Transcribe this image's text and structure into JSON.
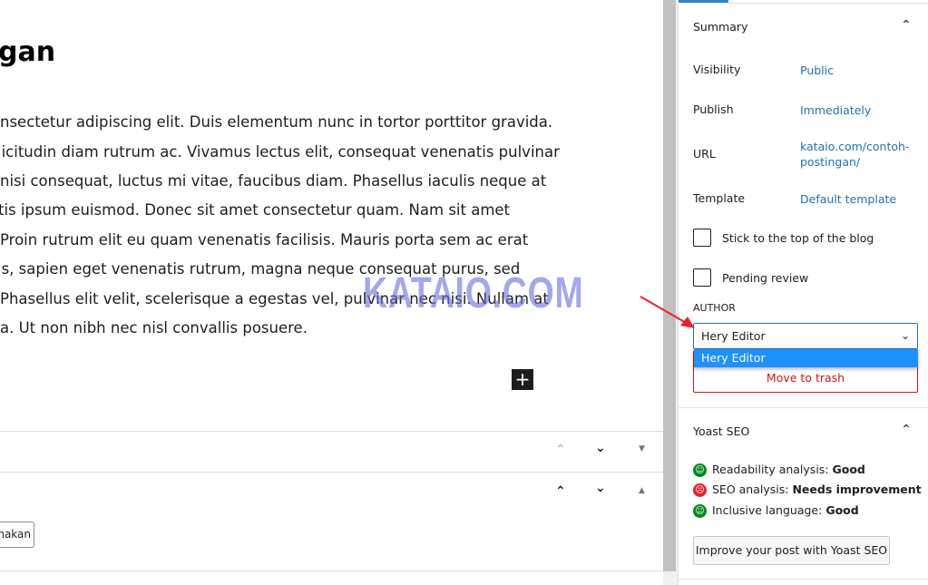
{
  "editor": {
    "title_fragment": "gan",
    "paragraph_lines": [
      "nsectetur adipiscing elit. Duis elementum nunc in tortor porttitor gravida.",
      "licitudin diam rutrum ac. Vivamus lectus elit, consequat venenatis pulvinar",
      " nisi consequat, luctus mi vitae, faucibus diam. Phasellus iaculis neque at",
      "tis ipsum euismod. Donec sit amet consectetur quam. Nam sit amet",
      "Proin rutrum elit eu quam venenatis facilisis. Mauris porta sem ac erat",
      "is, sapien eget venenatis rutrum, magna neque consequat purus, sed",
      "Phasellus elit velit, scelerisque a egestas vel, pulvinar nec nisi. Nullam at",
      "a. Ut non nibh nec nisl convallis posuere."
    ],
    "add_block_icon": "plus-icon",
    "watermark": "KATAIO.COM",
    "select_fragment": "nakan"
  },
  "sidebar": {
    "summary": {
      "title": "Summary",
      "rows": [
        {
          "label": "Visibility",
          "value": "Public"
        },
        {
          "label": "Publish",
          "value": "Immediately"
        },
        {
          "label": "URL",
          "value": "kataio.com/contoh-postingan/"
        },
        {
          "label": "Template",
          "value": "Default template"
        }
      ],
      "stick_label": "Stick to the top of the blog",
      "pending_label": "Pending review",
      "author_label": "AUTHOR",
      "author_value": "Hery Editor",
      "author_options": [
        "Hery Editor"
      ],
      "trash_label": "Move to trash"
    },
    "yoast": {
      "title": "Yoast SEO",
      "items": [
        {
          "label": "Readability analysis:",
          "value": "Good",
          "status": "good"
        },
        {
          "label": "SEO analysis:",
          "value": "Needs improvement",
          "status": "bad"
        },
        {
          "label": "Inclusive language:",
          "value": "Good",
          "status": "good"
        }
      ],
      "button": "Improve your post with Yoast SEO"
    }
  },
  "colors": {
    "link": "#2271b1",
    "accent": "#3582c4",
    "danger": "#cc1818",
    "good": "#008a20",
    "bad": "#e2252b",
    "highlight": "#1e90ff"
  }
}
